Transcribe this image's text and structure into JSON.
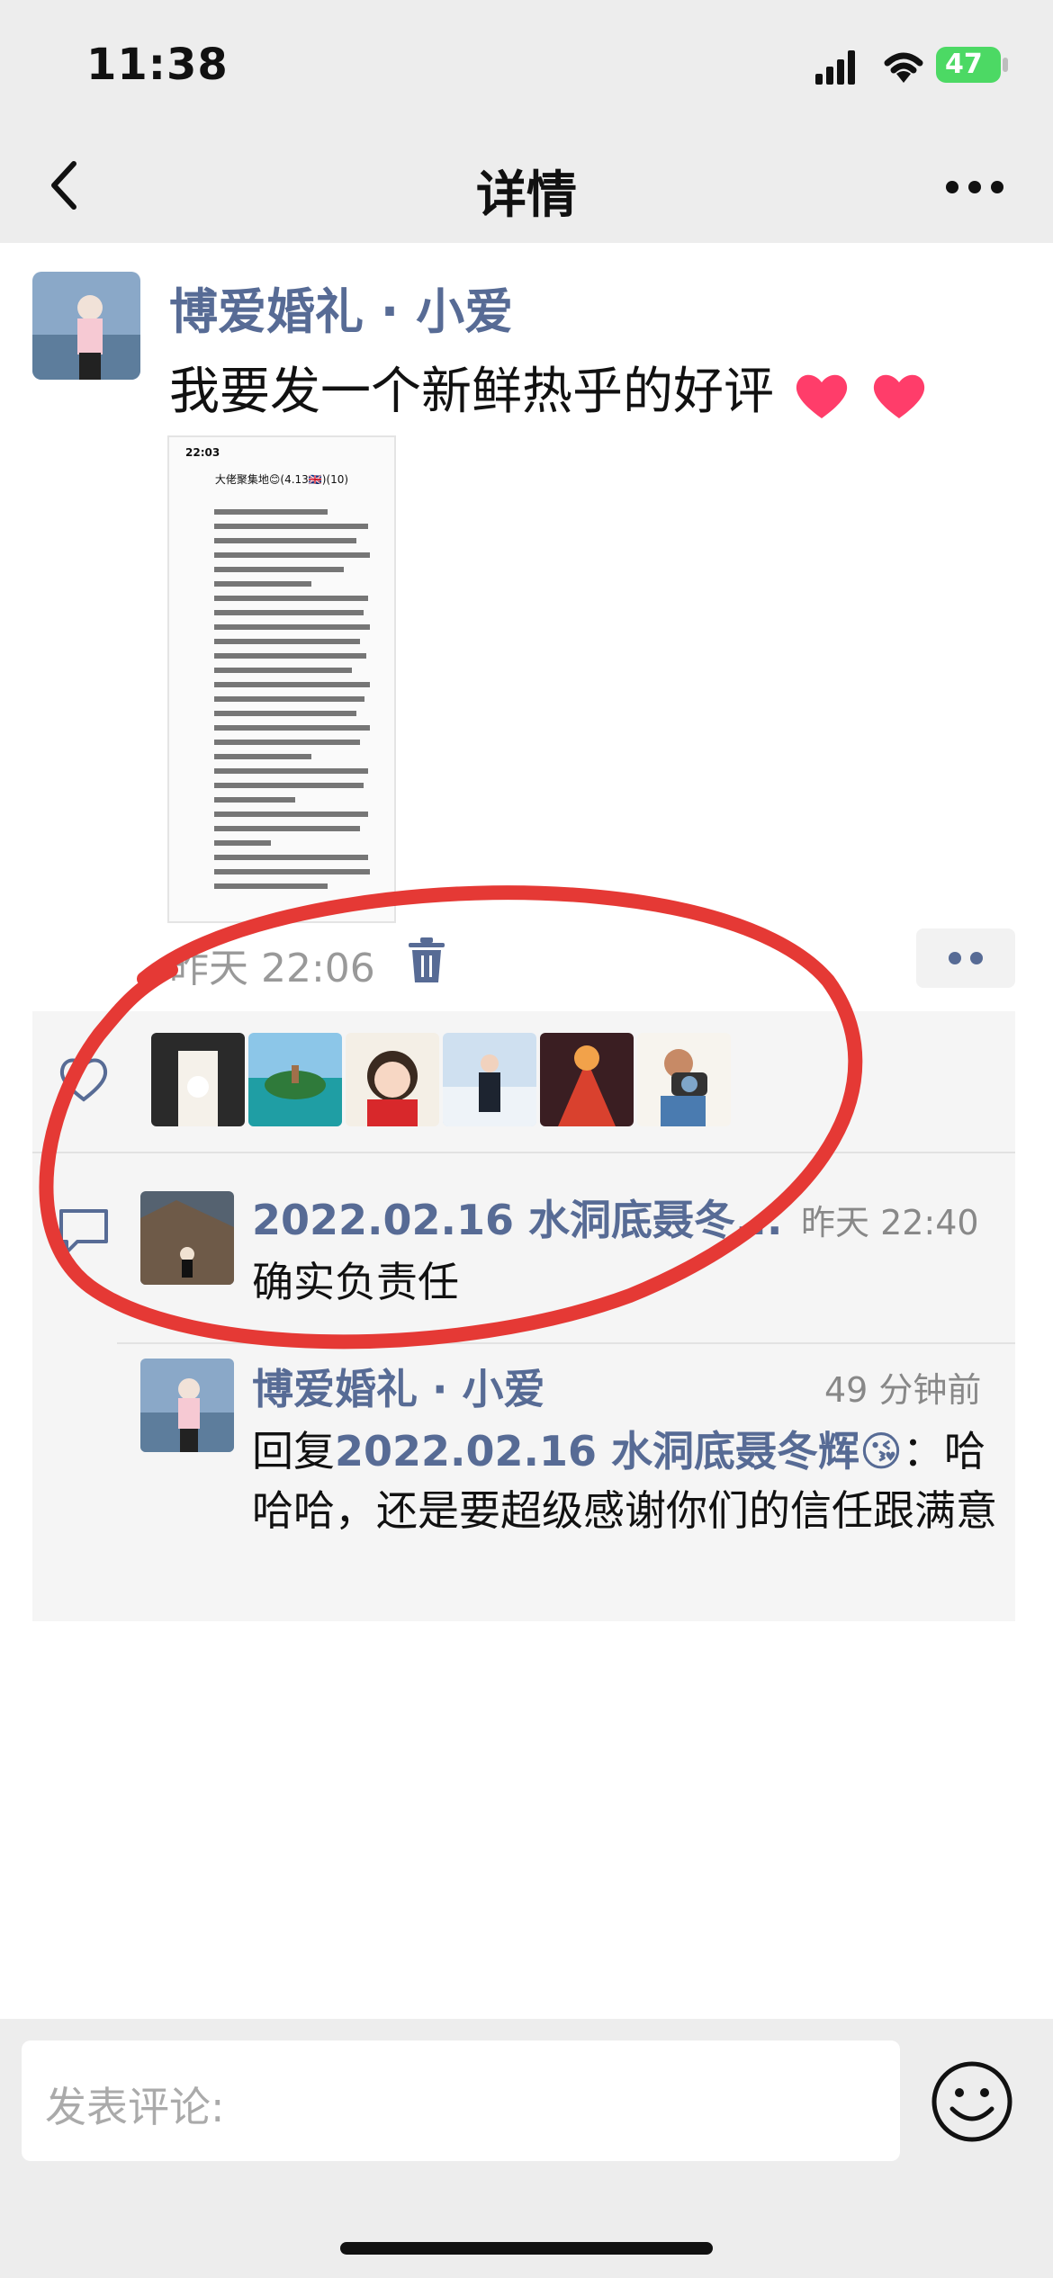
{
  "status": {
    "time": "11:38",
    "battery": "47"
  },
  "nav": {
    "title": "详情"
  },
  "post": {
    "author": "博爱婚礼 · 小爱",
    "text": "我要发一个新鲜热乎的好评",
    "time": "昨天 22:06",
    "screenshot": {
      "time": "22:03",
      "group": "大佬聚集地😊(4.13🇬🇧)(10)"
    }
  },
  "likes": {
    "avatars": [
      "avatar-1",
      "avatar-2",
      "avatar-3",
      "avatar-4",
      "avatar-5",
      "avatar-6"
    ]
  },
  "comments": [
    {
      "name": "2022.02.16 水洞底聂冬...",
      "time": "昨天 22:40",
      "text": "确实负责任"
    },
    {
      "name": "博爱婚礼 · 小爱",
      "time": "49 分钟前",
      "reply_prefix": "回复",
      "reply_to": "2022.02.16 水洞底聂冬辉😘",
      "text": "：哈哈哈，还是要超级感谢你们的信任跟满意"
    }
  ],
  "input": {
    "placeholder": "发表评论:"
  },
  "colors": {
    "link": "#576b95",
    "annotation": "#e53935",
    "battery": "#4cd964"
  }
}
